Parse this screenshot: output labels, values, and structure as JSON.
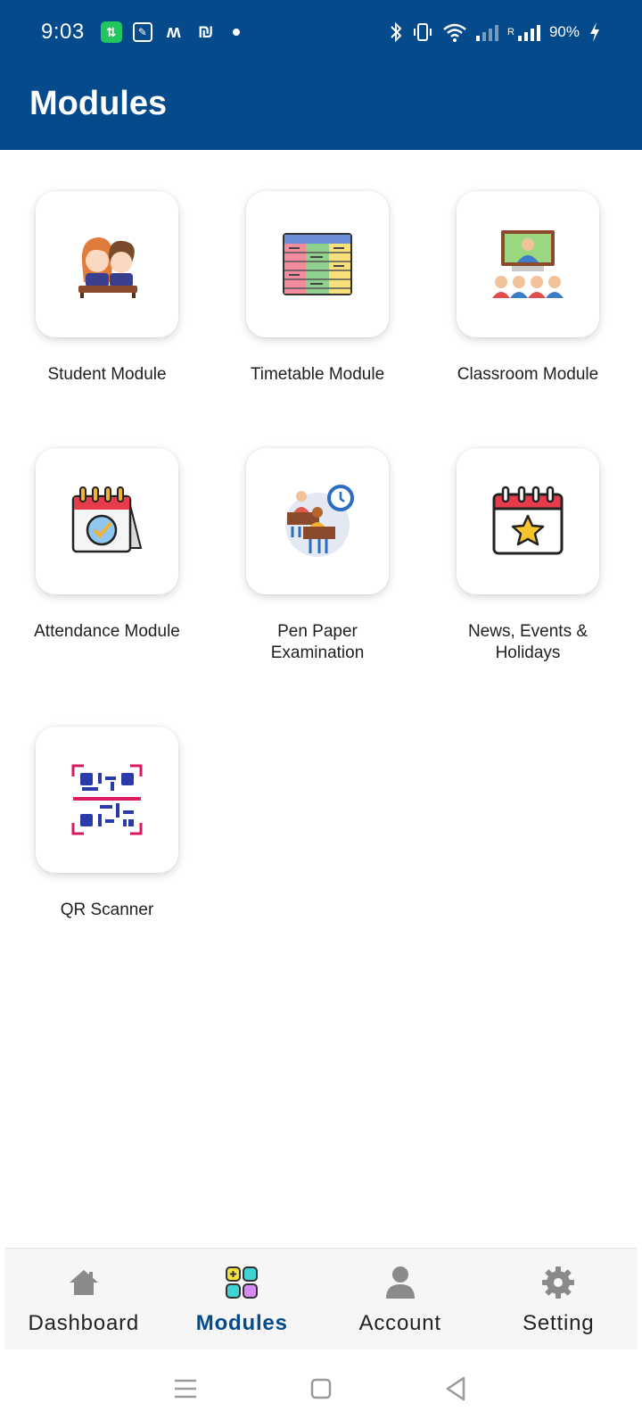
{
  "status_bar": {
    "time": "9:03",
    "battery": "90%",
    "icons": [
      "data-saver-icon",
      "calendar-app-icon",
      "m-app-icon",
      "sync-app-icon",
      "bluetooth-icon",
      "vibrate-icon",
      "wifi-icon",
      "signal-icon",
      "signal-roaming-icon",
      "charging-icon"
    ],
    "roaming_label": "R"
  },
  "header": {
    "title": "Modules"
  },
  "modules": [
    {
      "label": "Student Module",
      "icon": "students-icon"
    },
    {
      "label": "Timetable Module",
      "icon": "timetable-icon"
    },
    {
      "label": "Classroom Module",
      "icon": "classroom-icon"
    },
    {
      "label": "Attendance Module",
      "icon": "attendance-calendar-icon"
    },
    {
      "label": "Pen Paper Examination",
      "icon": "exam-icon"
    },
    {
      "label": "News, Events & Holidays",
      "icon": "events-calendar-icon"
    },
    {
      "label": "QR Scanner",
      "icon": "qr-scanner-icon"
    }
  ],
  "bottom_nav": {
    "active": "Modules",
    "active_color": "#054a8b",
    "items": [
      {
        "label": "Dashboard",
        "icon": "home-icon"
      },
      {
        "label": "Modules",
        "icon": "modules-grid-icon"
      },
      {
        "label": "Account",
        "icon": "person-icon"
      },
      {
        "label": "Setting",
        "icon": "gear-icon"
      }
    ]
  },
  "system_nav": [
    "menu-icon",
    "home-square-icon",
    "back-icon"
  ],
  "colors": {
    "primary": "#054a8b"
  }
}
